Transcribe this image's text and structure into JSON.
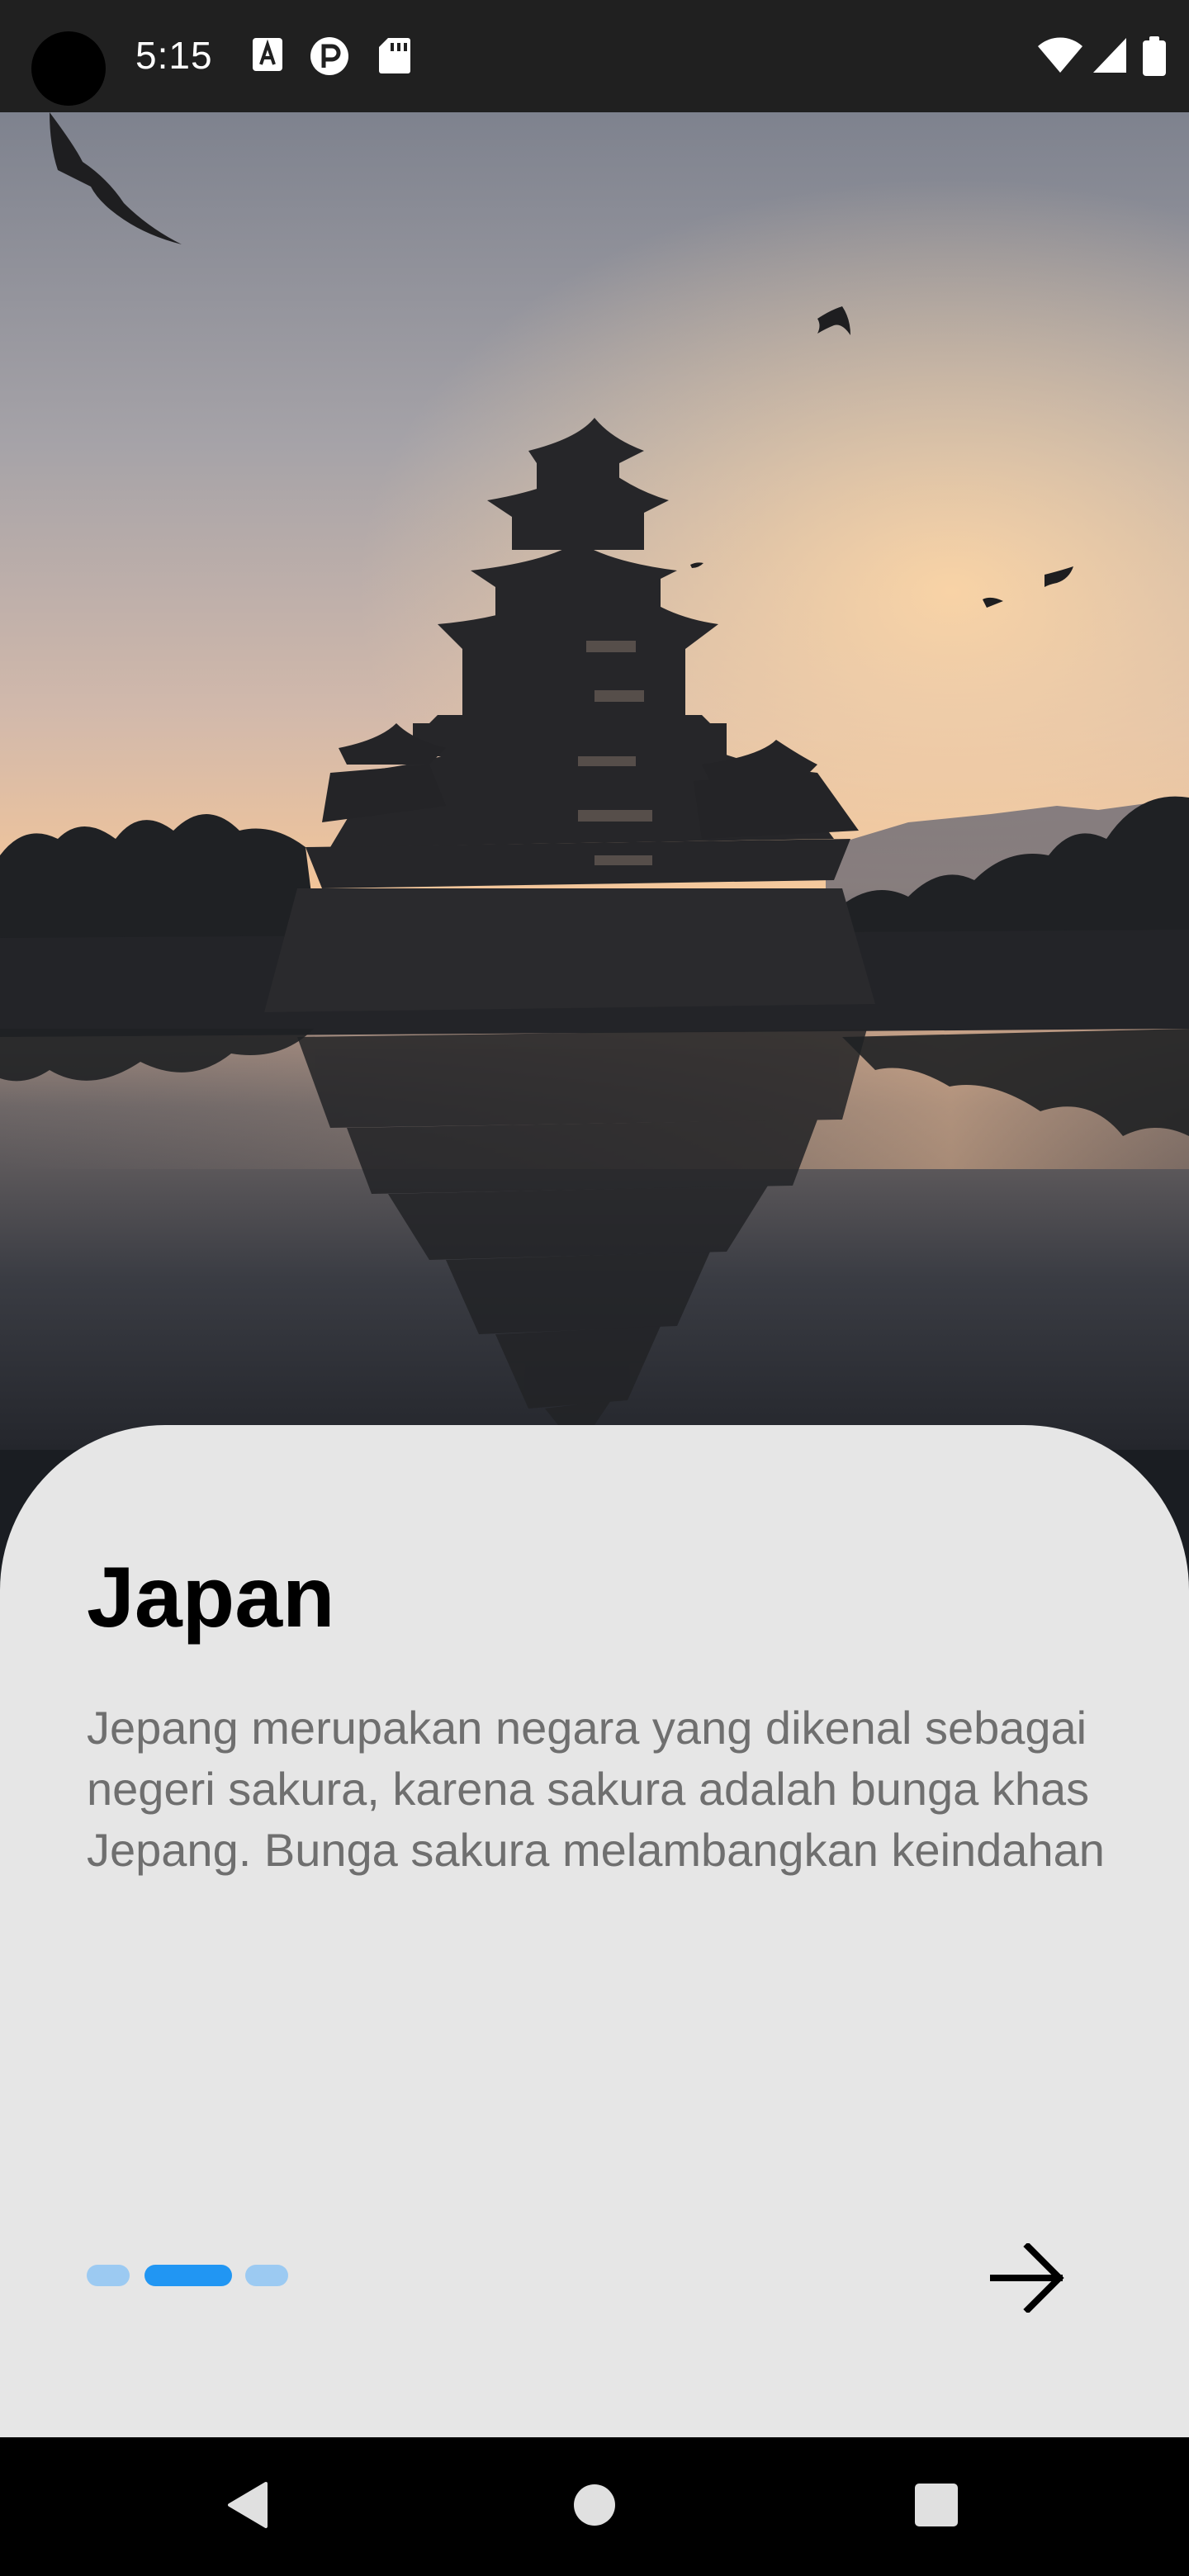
{
  "status_bar": {
    "time": "5:15",
    "icons_left": [
      "text-a-icon",
      "p-circle-icon",
      "sd-card-icon"
    ],
    "icons_right": [
      "wifi-icon",
      "signal-icon",
      "battery-icon"
    ]
  },
  "hero": {
    "image": "japanese-castle-at-sunset-photo"
  },
  "card": {
    "title": "Japan",
    "description": "Jepang merupakan negara yang dikenal sebagai negeri sakura, karena sakura adalah bunga khas Jepang. Bunga sakura melambangkan keindahan",
    "page_indicator": {
      "count": 3,
      "active_index": 1
    },
    "next_icon": "arrow-right-icon"
  },
  "nav_bar": {
    "buttons": [
      "back-icon",
      "home-icon",
      "recents-icon"
    ]
  },
  "colors": {
    "accent": "#2196f3",
    "accent_light": "#9ccaf2",
    "card_bg": "#e6e6e6",
    "text_secondary": "#6f6f6f"
  }
}
